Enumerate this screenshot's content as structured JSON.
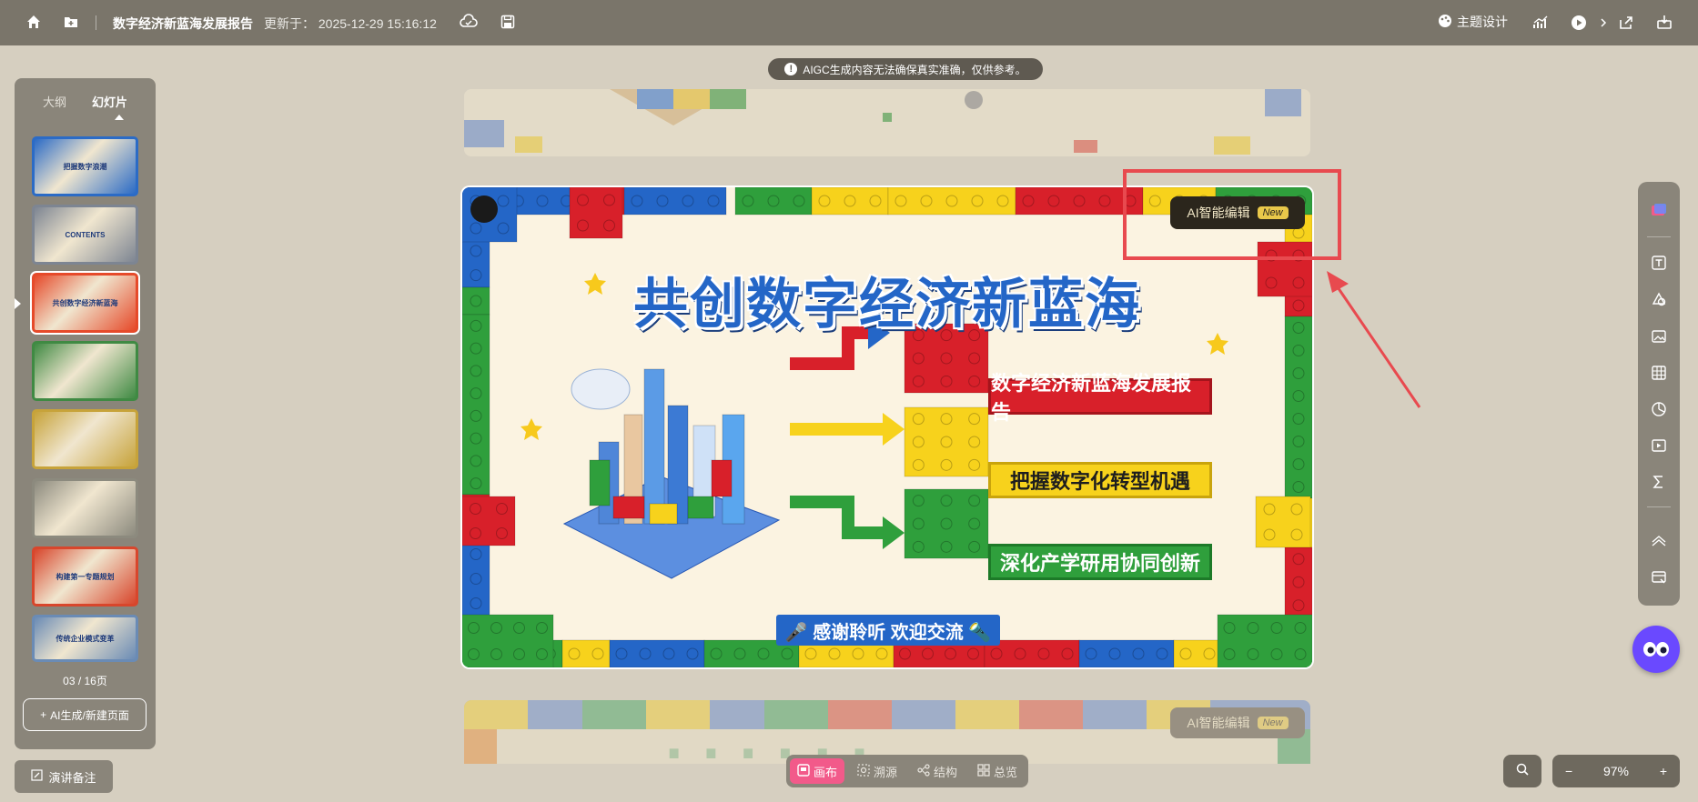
{
  "topbar": {
    "doc_title": "数字经济新蓝海发展报告",
    "updated": "更新于：  2025-12-29 15:16:12",
    "theme_label": "主题设计",
    "icons": [
      "home-icon",
      "folder-add-icon",
      "cloud-icon",
      "save-icon",
      "theme-icon",
      "chart-icon",
      "play-icon",
      "chevron-right-icon",
      "share-icon",
      "inbox-icon"
    ]
  },
  "notice": {
    "text": "AIGC生成内容无法确保真实准确，仅供参考。"
  },
  "leftpanel": {
    "tabs": [
      {
        "label": "大纲"
      },
      {
        "label": "幻灯片"
      }
    ],
    "thumbnails": [
      {
        "caption": "把握数字浪潮",
        "bg": "#2b6bc6"
      },
      {
        "caption": "CONTENTS",
        "bg": "#7d8592"
      },
      {
        "caption": "共创数字经济新蓝海",
        "bg": "#e64a2a"
      },
      {
        "caption": "",
        "bg": "#3f8a43"
      },
      {
        "caption": "",
        "bg": "#c7a33a"
      },
      {
        "caption": "",
        "bg": "#8c8a7e"
      },
      {
        "caption": "构建第一专题规划",
        "bg": "#d8462c"
      },
      {
        "caption": "传统企业模式变革",
        "bg": "#6a8bb5"
      }
    ],
    "page_count": "03 / 16页",
    "ai_generate_label": "AI生成/新建页面"
  },
  "notes_label": "演讲备注",
  "slide": {
    "title": "共创数字经济新蓝海",
    "items": [
      {
        "label": "数字经济新蓝海发展报告",
        "color": "#d8202a"
      },
      {
        "label": "把握数字化转型机遇",
        "color": "#f7d21c"
      },
      {
        "label": "深化产学研用协同创新",
        "color": "#2f9f3c"
      }
    ],
    "thanks": "🎤 感谢聆听  欢迎交流 🔦",
    "ai_edit_label": "AI智能编辑",
    "new_tag": "New"
  },
  "next_slide": {
    "ai_edit_label": "AI智能编辑",
    "new_tag": "New"
  },
  "righttools": {
    "icons": [
      "palette-icon",
      "text-icon",
      "shapes-icon",
      "image-icon",
      "table-icon",
      "pie-chart-icon",
      "media-icon",
      "formula-icon",
      "animation-icon",
      "layout-icon"
    ]
  },
  "view_switch": {
    "items": [
      {
        "label": "画布"
      },
      {
        "label": "溯源"
      },
      {
        "label": "结构"
      },
      {
        "label": "总览"
      }
    ]
  },
  "zoom": {
    "minus": "−",
    "value": "97%",
    "plus": "+"
  },
  "colors": {
    "accent": "#f25a8a",
    "topbar": "#7a756a",
    "highlight": "#e84a4f"
  }
}
